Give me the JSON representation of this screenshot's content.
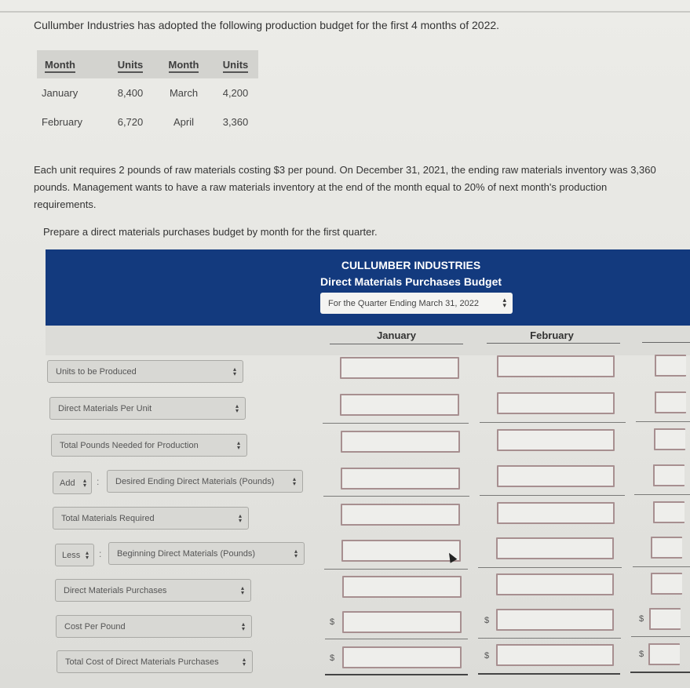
{
  "problem": {
    "intro": "Cullumber Industries has adopted the following production budget for the first 4 months of 2022.",
    "production_table": {
      "headers": [
        "Month",
        "Units",
        "Month",
        "Units"
      ],
      "rows": [
        [
          "January",
          "8,400",
          "March",
          "4,200"
        ],
        [
          "February",
          "6,720",
          "April",
          "3,360"
        ]
      ]
    },
    "paragraph": "Each unit requires 2 pounds of raw materials costing $3 per pound. On December 31, 2021, the ending raw materials inventory was 3,360 pounds. Management wants to have a raw materials inventory at the end of the month equal to 20% of next month's production requirements.",
    "instruction": "Prepare a direct materials purchases budget by month for the first quarter."
  },
  "budget": {
    "company": "CULLUMBER INDUSTRIES",
    "title": "Direct Materials Purchases Budget",
    "period_select": "For the Quarter Ending March 31, 2022",
    "columns": [
      "January",
      "February",
      ""
    ],
    "rows": [
      {
        "label": "Units to be Produced",
        "prefix": null,
        "values": [
          "",
          "",
          ""
        ]
      },
      {
        "label": "Direct Materials Per Unit",
        "prefix": null,
        "values": [
          "",
          "",
          ""
        ]
      },
      {
        "label": "Total Pounds Needed for Production",
        "prefix": null,
        "values": [
          "",
          "",
          ""
        ]
      },
      {
        "label": "Desired Ending Direct Materials (Pounds)",
        "prefix": "Add",
        "values": [
          "",
          "",
          ""
        ]
      },
      {
        "label": "Total Materials Required",
        "prefix": null,
        "values": [
          "",
          "",
          ""
        ]
      },
      {
        "label": "Beginning Direct Materials (Pounds)",
        "prefix": "Less",
        "values": [
          "",
          "",
          ""
        ]
      },
      {
        "label": "Direct Materials Purchases",
        "prefix": null,
        "values": [
          "",
          "",
          ""
        ]
      },
      {
        "label": "Cost Per Pound",
        "prefix": null,
        "currency": "$",
        "values": [
          "",
          "",
          ""
        ]
      },
      {
        "label": "Total Cost of Direct Materials Purchases",
        "prefix": null,
        "currency": "$",
        "values": [
          "",
          "",
          ""
        ]
      }
    ],
    "colon": ":",
    "select_arrows": "▴▾"
  },
  "colors": {
    "header_bg": "#133a7e",
    "input_border": "#a78f90"
  }
}
